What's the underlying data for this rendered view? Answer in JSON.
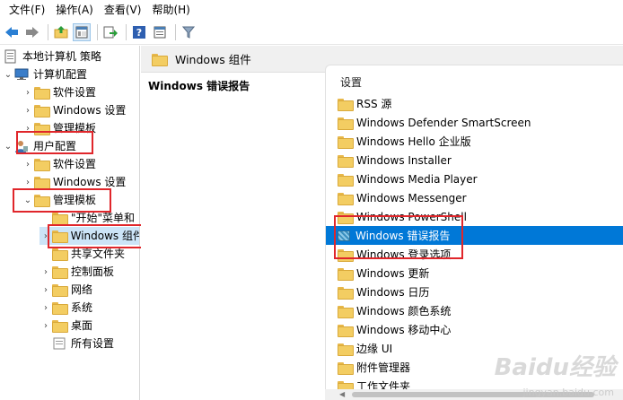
{
  "menu": {
    "items": [
      "文件(F)",
      "操作(A)",
      "查看(V)",
      "帮助(H)"
    ]
  },
  "toolbar": {
    "icons": [
      "back-icon",
      "forward-icon",
      "up-folder-icon",
      "show-hide-tree-icon",
      "export-list-icon",
      "help-icon",
      "properties-icon",
      "filter-icon"
    ]
  },
  "tree": {
    "root": "本地计算机 策略",
    "computer_config": "计算机配置",
    "cc_software": "软件设置",
    "cc_windows": "Windows 设置",
    "cc_admin": "管理模板",
    "user_config": "用户配置",
    "uc_software": "软件设置",
    "uc_windows": "Windows 设置",
    "uc_admin": "管理模板",
    "start_menu": "\"开始\"菜单和",
    "windows_components": "Windows 组件",
    "shared_folders": "共享文件夹",
    "control_panel": "控制面板",
    "network": "网络",
    "system": "系统",
    "desktop": "桌面",
    "all_settings": "所有设置"
  },
  "middle": {
    "header": "Windows 组件",
    "description_title": "Windows 错误报告"
  },
  "list": {
    "column_header": "设置",
    "items": [
      "RSS 源",
      "Windows Defender SmartScreen",
      "Windows Hello 企业版",
      "Windows Installer",
      "Windows Media Player",
      "Windows Messenger",
      "Windows PowerShell",
      "Windows 错误报告",
      "Windows 登录选项",
      "Windows 更新",
      "Windows 日历",
      "Windows 颜色系统",
      "Windows 移动中心",
      "边缘 UI",
      "附件管理器",
      "工作文件夹"
    ],
    "selected_index": 7
  },
  "watermark": {
    "text": "Baidu经验",
    "url": "jingyan.baidu.com"
  },
  "colors": {
    "selection": "#0078d7",
    "highlight_box": "#e0262b",
    "folder": "#f3cd62"
  }
}
